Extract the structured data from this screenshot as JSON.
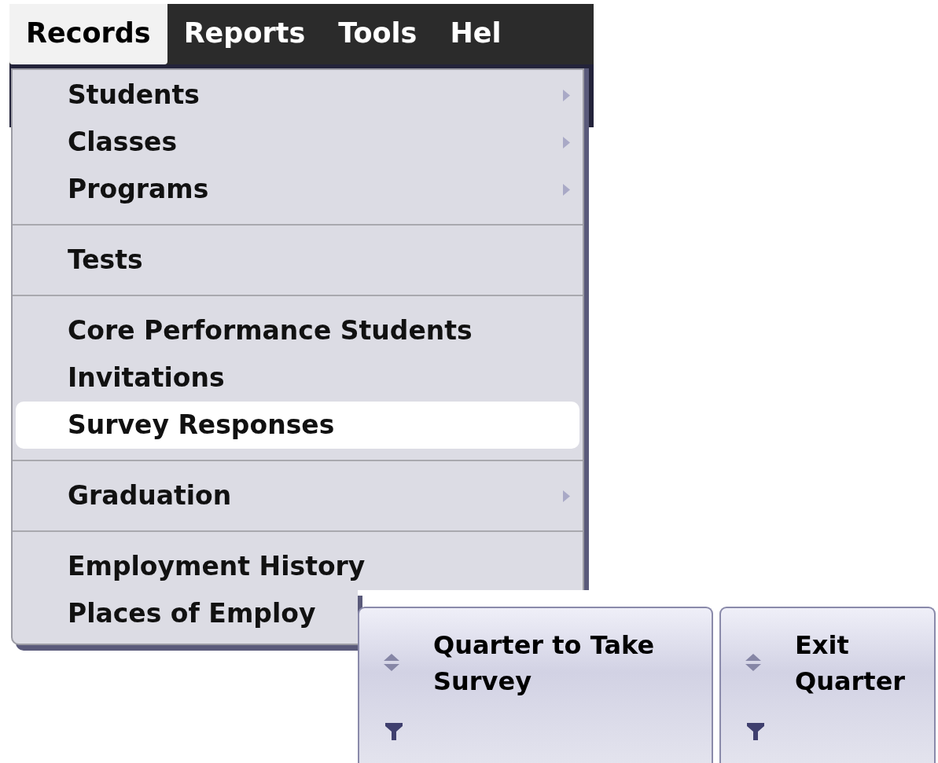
{
  "menubar": [
    {
      "label": "Records",
      "selected": true
    },
    {
      "label": "Reports",
      "selected": false
    },
    {
      "label": "Tools",
      "selected": false
    },
    {
      "label": "Hel",
      "selected": false
    }
  ],
  "menu": {
    "groups": [
      [
        {
          "label": "Students",
          "submenu": true,
          "selected": false
        },
        {
          "label": "Classes",
          "submenu": true,
          "selected": false
        },
        {
          "label": "Programs",
          "submenu": true,
          "selected": false
        }
      ],
      [
        {
          "label": "Tests",
          "submenu": false,
          "selected": false
        }
      ],
      [
        {
          "label": "Core Performance Students",
          "submenu": false,
          "selected": false
        },
        {
          "label": "Invitations",
          "submenu": false,
          "selected": false
        },
        {
          "label": "Survey Responses",
          "submenu": false,
          "selected": true
        }
      ],
      [
        {
          "label": "Graduation",
          "submenu": true,
          "selected": false
        }
      ],
      [
        {
          "label": "Employment History",
          "submenu": false,
          "selected": false
        },
        {
          "label": "Places of Employ",
          "submenu": false,
          "selected": false
        }
      ]
    ]
  },
  "grid_headers": [
    {
      "title": "Quarter to Take Survey"
    },
    {
      "title": "Exit Quarter"
    }
  ]
}
